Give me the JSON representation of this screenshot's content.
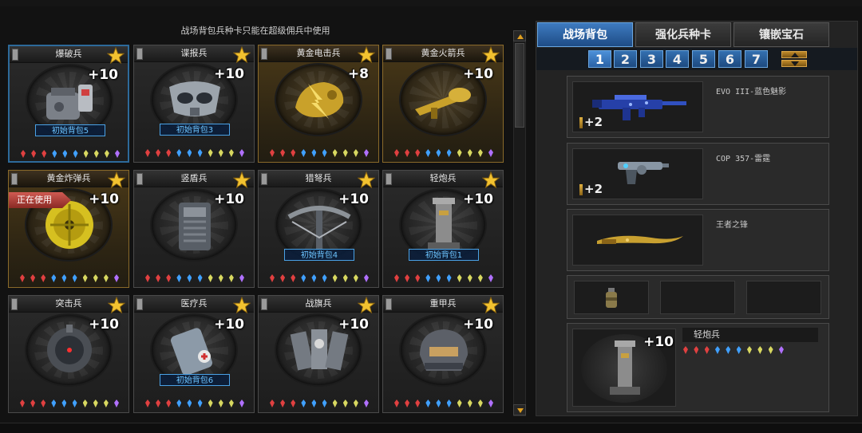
{
  "notice": "战场背包兵种卡只能在超级佣兵中使用",
  "cards": [
    {
      "name": "爆破兵",
      "bonus": "+10",
      "badge": "初始背包5",
      "gold": false,
      "selected": true,
      "icon": "demolition-icon"
    },
    {
      "name": "谍报兵",
      "bonus": "+10",
      "badge": "初始背包3",
      "gold": false,
      "icon": "spy-mask-icon"
    },
    {
      "name": "黄金电击兵",
      "bonus": "+8",
      "badge": "",
      "gold": true,
      "icon": "golden-thunder-icon"
    },
    {
      "name": "黄金火箭兵",
      "bonus": "+10",
      "badge": "",
      "gold": true,
      "icon": "golden-rocket-icon"
    },
    {
      "name": "黄金炸弹兵",
      "bonus": "+10",
      "badge": "",
      "gold": true,
      "in_use": "正在使用",
      "icon": "golden-bomb-icon"
    },
    {
      "name": "竖盾兵",
      "bonus": "+10",
      "badge": "",
      "gold": false,
      "icon": "shield-icon"
    },
    {
      "name": "猎弩兵",
      "bonus": "+10",
      "badge": "初始背包4",
      "gold": false,
      "icon": "crossbow-icon"
    },
    {
      "name": "轻炮兵",
      "bonus": "+10",
      "badge": "初始背包1",
      "gold": false,
      "icon": "mortar-icon"
    },
    {
      "name": "突击兵",
      "bonus": "+10",
      "badge": "",
      "gold": false,
      "icon": "assault-device-icon"
    },
    {
      "name": "医疗兵",
      "bonus": "+10",
      "badge": "初始背包6",
      "gold": false,
      "icon": "medkit-icon"
    },
    {
      "name": "战旗兵",
      "bonus": "+10",
      "badge": "",
      "gold": false,
      "icon": "flags-icon"
    },
    {
      "name": "重甲兵",
      "bonus": "+10",
      "badge": "",
      "gold": false,
      "icon": "heavy-armor-icon"
    }
  ],
  "gem_colors": [
    "#e04040",
    "#e04040",
    "#e04040",
    "#40a0ff",
    "#40a0ff",
    "#40a0ff",
    "#d8d860",
    "#d8d860",
    "#d8d860",
    "#b070ff"
  ],
  "tabs": [
    "战场背包",
    "强化兵种卡",
    "镶嵌宝石"
  ],
  "pages": [
    "1",
    "2",
    "3",
    "4",
    "5",
    "6",
    "7"
  ],
  "active_page": "1",
  "equipment": [
    {
      "name": "EVO III-蓝色魅影",
      "ammo": "+2",
      "icon": "smg-blue-icon"
    },
    {
      "name": "COP 357-雷霆",
      "ammo": "+2",
      "icon": "pistol-icon"
    },
    {
      "name": "王者之锋",
      "ammo": "",
      "icon": "golden-blade-icon"
    }
  ],
  "grenade_icon": "grenade-icon",
  "soldier": {
    "name": "轻炮兵",
    "bonus": "+10",
    "icon": "mortar-icon"
  }
}
